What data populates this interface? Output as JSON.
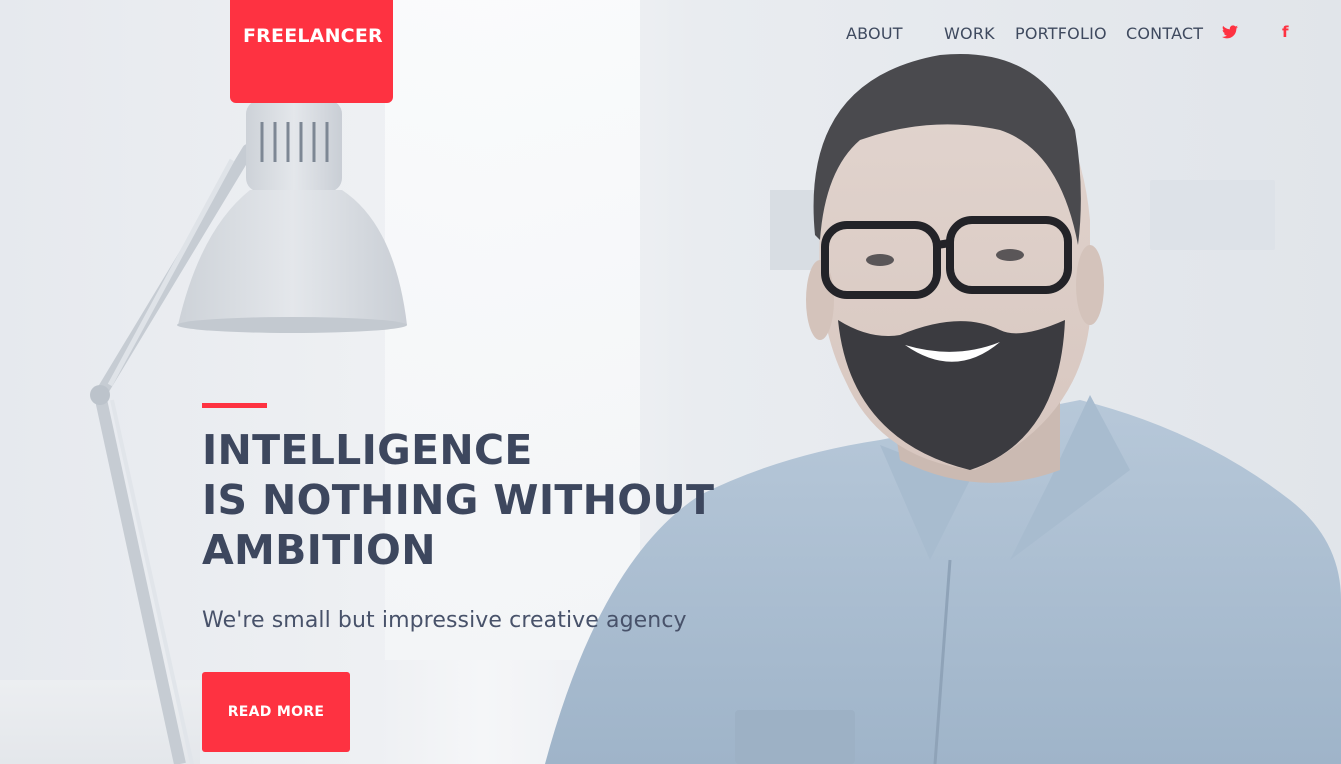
{
  "brand": {
    "logo_text": "FREELANCER",
    "accent_color": "#fe3241",
    "text_color": "#3d475e"
  },
  "nav": {
    "items": [
      {
        "label": "ABOUT"
      },
      {
        "label": "WORK"
      },
      {
        "label": "PORTFOLIO"
      },
      {
        "label": "CONTACT"
      }
    ],
    "social": [
      {
        "icon": "twitter-icon",
        "glyph": "🐦"
      },
      {
        "icon": "facebook-icon",
        "glyph": "f"
      }
    ]
  },
  "hero": {
    "headline_lines": [
      "INTELLIGENCE",
      "IS NOTHING WITHOUT",
      "AMBITION"
    ],
    "subtitle": "We're small but impressive creative agency",
    "cta_label": "READ MORE"
  },
  "background": {
    "photo_subject": "smiling man with glasses and beard in denim shirt",
    "props": [
      "desk lamp",
      "window",
      "desk"
    ]
  }
}
